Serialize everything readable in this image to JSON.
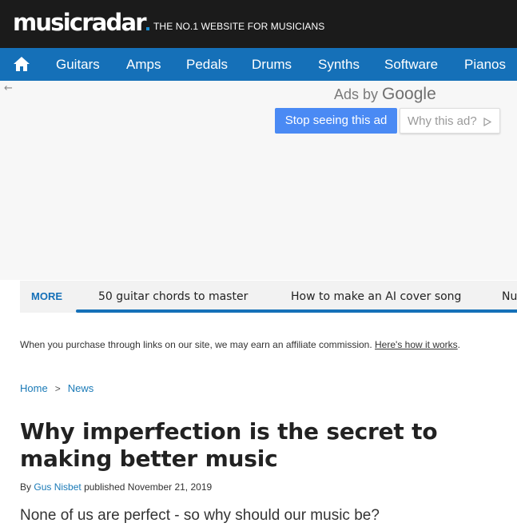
{
  "header": {
    "logo_text": "musicradar",
    "tagline": "THE NO.1 WEBSITE FOR MUSICIANS"
  },
  "nav": {
    "home_icon": "home-icon",
    "items": [
      "Guitars",
      "Amps",
      "Pedals",
      "Drums",
      "Synths",
      "Software",
      "Pianos"
    ]
  },
  "ad": {
    "back_icon": "back-arrow-icon",
    "ads_by": "Ads by",
    "google": "Google",
    "stop_label": "Stop seeing this ad",
    "why_label": "Why this ad?",
    "why_icon": "play-triangle-icon"
  },
  "more_bar": {
    "label": "MORE",
    "links": [
      "50 guitar chords to master",
      "How to make an AI cover song",
      "Nu"
    ]
  },
  "affiliate": {
    "text": "When you purchase through links on our site, we may earn an affiliate commission.",
    "link": "Here's how it works",
    "end": "."
  },
  "breadcrumb": {
    "items": [
      "Home",
      "News"
    ],
    "separator": ">"
  },
  "article": {
    "title": "Why imperfection is the secret to making better music",
    "by": "By",
    "author": "Gus Nisbet",
    "published": "published November 21, 2019",
    "standfirst": "None of us are perfect - so why should our music be?"
  },
  "colors": {
    "topbar": "#1b1b1b",
    "nav": "#1570b8",
    "accent": "#1a7ab7",
    "ad_button": "#4a8af4"
  }
}
